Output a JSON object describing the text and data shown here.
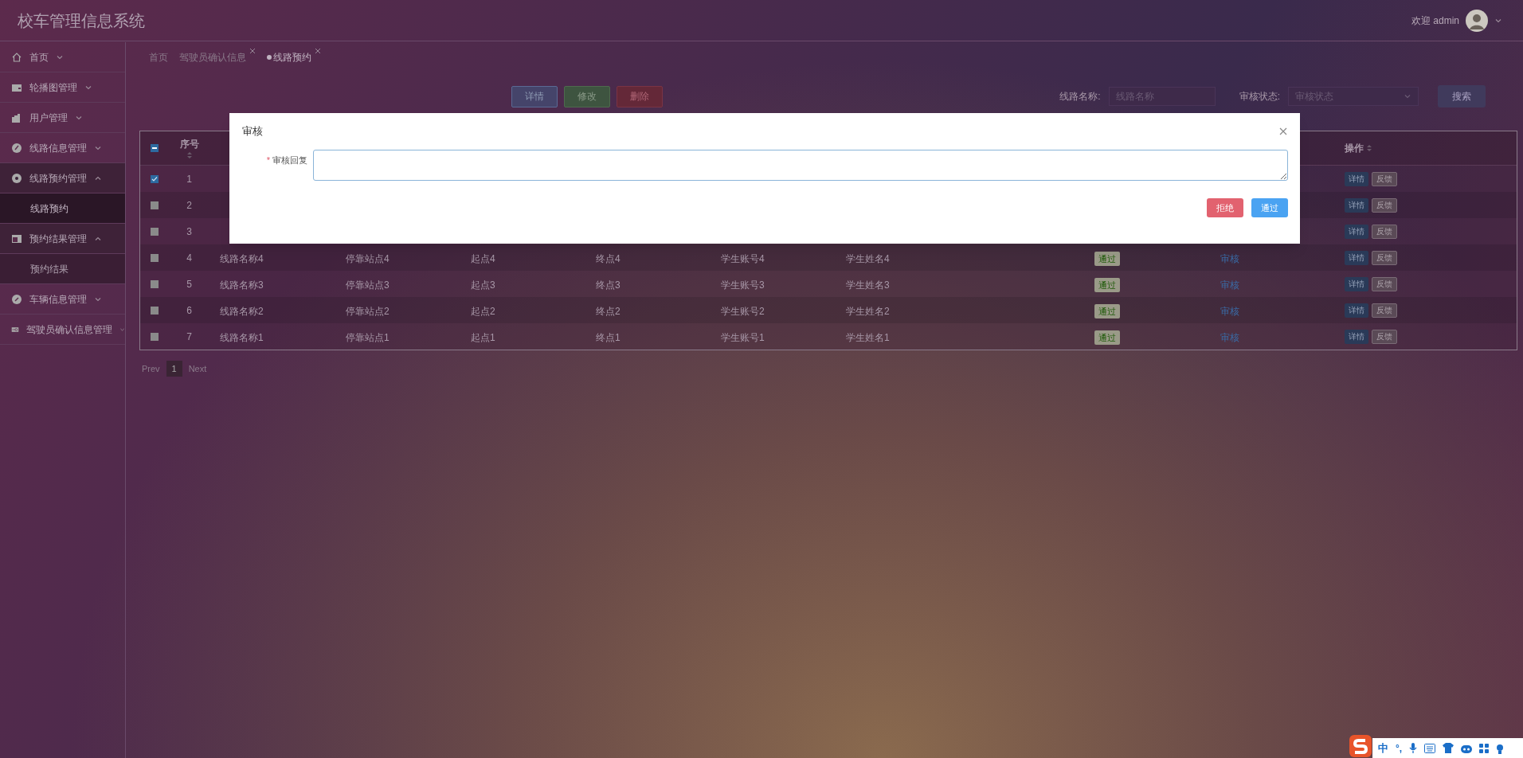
{
  "header": {
    "title": "校车管理信息系统",
    "welcome": "欢迎 admin"
  },
  "sidebar": {
    "items": [
      {
        "label": "首页",
        "expanded": false
      },
      {
        "label": "轮播图管理",
        "expanded": false
      },
      {
        "label": "用户管理",
        "expanded": false
      },
      {
        "label": "线路信息管理",
        "expanded": false
      },
      {
        "label": "线路预约管理",
        "expanded": true,
        "children": [
          {
            "label": "线路预约",
            "selected": true
          }
        ]
      },
      {
        "label": "预约结果管理",
        "expanded": true,
        "children": [
          {
            "label": "预约结果",
            "selected": false
          }
        ]
      },
      {
        "label": "车辆信息管理",
        "expanded": false
      },
      {
        "label": "驾驶员确认信息管理",
        "expanded": false
      }
    ]
  },
  "tabs": [
    {
      "label": "首页",
      "closable": false,
      "selected": false
    },
    {
      "label": "驾驶员确认信息",
      "closable": true,
      "selected": false
    },
    {
      "label": "线路预约",
      "closable": true,
      "selected": true
    }
  ],
  "toolbar": {
    "buttons": [
      {
        "label": "详情",
        "kind": "info"
      },
      {
        "label": "修改",
        "kind": "success"
      },
      {
        "label": "删除",
        "kind": "danger"
      }
    ],
    "filters": [
      {
        "label": "线路名称:",
        "placeholder": "线路名称",
        "kind": "input"
      },
      {
        "label": "审核状态:",
        "placeholder": "审核状态",
        "kind": "select"
      }
    ],
    "search_button": "搜索"
  },
  "table": {
    "header": {
      "select_all_indeterminate": true,
      "number": "序号",
      "actions": "操作"
    },
    "rows": [
      {
        "checked": true,
        "number": "1",
        "actions": [
          "详情",
          "反馈"
        ]
      },
      {
        "checked": false,
        "number": "2",
        "actions": [
          "详情",
          "反馈"
        ]
      },
      {
        "checked": false,
        "number": "3",
        "actions": [
          "详情",
          "反馈"
        ]
      },
      {
        "checked": false,
        "number": "4",
        "cells": [
          "线路名称4",
          "停靠站点4",
          "起点4",
          "终点4",
          "学生账号4",
          "学生姓名4"
        ],
        "status": "通过",
        "review": "审核",
        "actions": [
          "详情",
          "反馈"
        ]
      },
      {
        "checked": false,
        "number": "5",
        "cells": [
          "线路名称3",
          "停靠站点3",
          "起点3",
          "终点3",
          "学生账号3",
          "学生姓名3"
        ],
        "status": "通过",
        "review": "审核",
        "actions": [
          "详情",
          "反馈"
        ]
      },
      {
        "checked": false,
        "number": "6",
        "cells": [
          "线路名称2",
          "停靠站点2",
          "起点2",
          "终点2",
          "学生账号2",
          "学生姓名2"
        ],
        "status": "通过",
        "review": "审核",
        "actions": [
          "详情",
          "反馈"
        ]
      },
      {
        "checked": false,
        "number": "7",
        "cells": [
          "线路名称1",
          "停靠站点1",
          "起点1",
          "终点1",
          "学生账号1",
          "学生姓名1"
        ],
        "status": "通过",
        "review": "审核",
        "actions": [
          "详情",
          "反馈"
        ]
      }
    ]
  },
  "pagination": {
    "prev": "Prev",
    "pages": [
      {
        "label": "1",
        "selected": true
      }
    ],
    "next": "Next"
  },
  "dialog": {
    "title": "审核",
    "field": {
      "label": "审核回复",
      "required_mark": "*"
    },
    "buttons": [
      {
        "label": "拒绝",
        "kind": "danger"
      },
      {
        "label": "通过",
        "kind": "primary"
      }
    ]
  },
  "ime": {
    "language": "中",
    "punctuation": "°,"
  }
}
